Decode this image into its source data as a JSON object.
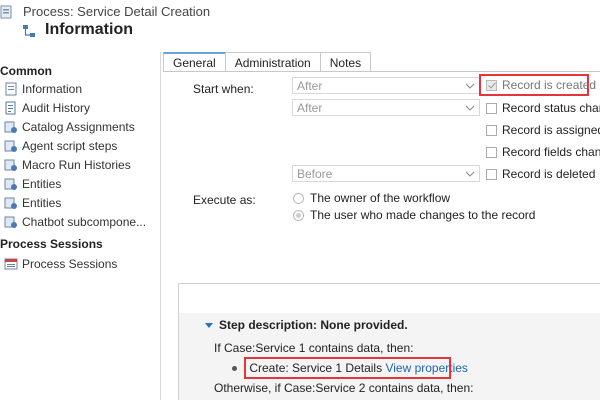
{
  "header": {
    "breadcrumb": "Process: Service Detail Creation",
    "title": "Information"
  },
  "sidebar": {
    "sections": [
      {
        "label": "Common",
        "items": [
          {
            "label": "Information",
            "icon": "info-page-icon"
          },
          {
            "label": "Audit History",
            "icon": "audit-history-icon"
          },
          {
            "label": "Catalog Assignments",
            "icon": "gear-entity-icon"
          },
          {
            "label": "Agent script steps",
            "icon": "gear-entity-icon"
          },
          {
            "label": "Macro Run Histories",
            "icon": "gear-entity-icon"
          },
          {
            "label": "Entities",
            "icon": "gear-entity-icon"
          },
          {
            "label": "Entities",
            "icon": "gear-entity-icon"
          },
          {
            "label": "Chatbot subcompone...",
            "icon": "gear-entity-icon"
          }
        ]
      },
      {
        "label": "Process Sessions",
        "items": [
          {
            "label": "Process Sessions",
            "icon": "process-sessions-icon"
          }
        ]
      }
    ]
  },
  "tabs": [
    {
      "label": "General",
      "active": true
    },
    {
      "label": "Administration",
      "active": false
    },
    {
      "label": "Notes",
      "active": false
    }
  ],
  "general": {
    "start_when_label": "Start when:",
    "selects": [
      "After",
      "After",
      "Before"
    ],
    "options": [
      {
        "label": "Record is created",
        "checked": true,
        "disabled": true
      },
      {
        "label": "Record status change",
        "checked": false
      },
      {
        "label": "Record is assigned",
        "checked": false
      },
      {
        "label": "Record fields change",
        "checked": false
      },
      {
        "label": "Record is deleted",
        "checked": false
      }
    ],
    "execute_as_label": "Execute as:",
    "execute_options": [
      {
        "label": "The owner of the workflow",
        "selected": false
      },
      {
        "label": "The user who made changes to the record",
        "selected": true
      }
    ]
  },
  "step": {
    "description": "Step description: None provided.",
    "condition": "If Case:Service 1 contains data, then:",
    "create_prefix": "Create:",
    "create_target": "Service 1 Details",
    "view_link": "View properties",
    "otherwise": "Otherwise, if Case:Service 2 contains data, then:"
  },
  "colors": {
    "highlight": "#e5343a",
    "link": "#1e63b6",
    "tab_accent": "#6aa2e0"
  }
}
